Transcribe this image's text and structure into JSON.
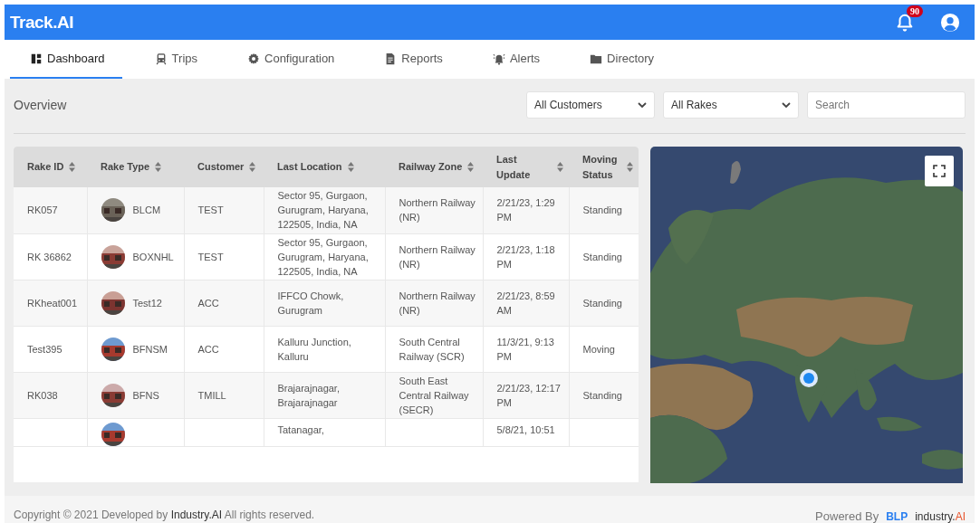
{
  "header": {
    "brand": "Track.AI",
    "notification_count": "90"
  },
  "tabs": [
    {
      "label": "Dashboard",
      "selected": true
    },
    {
      "label": "Trips",
      "selected": false
    },
    {
      "label": "Configuration",
      "selected": false
    },
    {
      "label": "Reports",
      "selected": false
    },
    {
      "label": "Alerts",
      "selected": false
    },
    {
      "label": "Directory",
      "selected": false
    }
  ],
  "overview": {
    "title": "Overview",
    "filters": [
      "All Customers",
      "All Rakes"
    ],
    "search": {
      "placeholder": "Search"
    }
  },
  "table": {
    "columns": [
      "Rake ID",
      "Rake Type",
      "Customer",
      "Last Location",
      "Railway Zone",
      "Last Update",
      "Moving Status"
    ],
    "rows": [
      {
        "rake_id": "RK057",
        "rake_type": "BLCM",
        "customer": "TEST",
        "last_location": "Sector 95, Gurgaon, Gurugram, Haryana, 122505, India, NA",
        "railway_zone": "Northern Railway (NR)",
        "last_update": "2/21/23, 1:29 PM",
        "moving_status": "Standing"
      },
      {
        "rake_id": "RK 36862",
        "rake_type": "BOXNHL",
        "customer": "TEST",
        "last_location": "Sector 95, Gurgaon, Gurugram, Haryana, 122505, India, NA",
        "railway_zone": "Northern Railway (NR)",
        "last_update": "2/21/23, 1:18 PM",
        "moving_status": "Standing"
      },
      {
        "rake_id": "RKheat001",
        "rake_type": "Test12",
        "customer": "ACC",
        "last_location": "IFFCO Chowk, Gurugram",
        "railway_zone": "Northern Railway (NR)",
        "last_update": "2/21/23, 8:59 AM",
        "moving_status": "Standing"
      },
      {
        "rake_id": "Test395",
        "rake_type": "BFNSM",
        "customer": "ACC",
        "last_location": "Kalluru Junction, Kalluru",
        "railway_zone": "South Central Railway (SCR)",
        "last_update": "11/3/21, 9:13 PM",
        "moving_status": "Moving"
      },
      {
        "rake_id": "RK038",
        "rake_type": "BFNS",
        "customer": "TMILL",
        "last_location": "Brajarajnagar, Brajarajnagar",
        "railway_zone": "South East Central Railway (SECR)",
        "last_update": "2/21/23, 12:17 PM",
        "moving_status": "Standing"
      },
      {
        "last_location": "Tatanagar,",
        "last_update": "5/8/21, 10:51"
      }
    ]
  },
  "footer": {
    "copyright": "Copyright © 2021 Developed by **Industry.AI** All rights reserved.",
    "powered_by": "Powered By",
    "logos": [
      "BLP",
      "industry.**AI**"
    ]
  }
}
